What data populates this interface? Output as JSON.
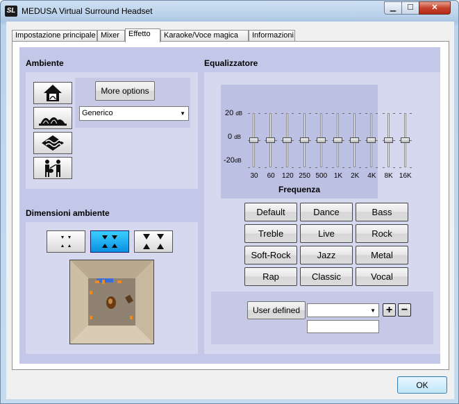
{
  "window": {
    "title": "MEDUSA Virtual Surround Headset",
    "icon_text": "SL",
    "close_glyph": "✕",
    "min_glyph": "▁",
    "max_glyph": "☐"
  },
  "tabs": [
    {
      "label": "Impostazione principale"
    },
    {
      "label": "Mixer"
    },
    {
      "label": "Effetto",
      "active": true
    },
    {
      "label": "Karaoke/Voce magica"
    },
    {
      "label": "Informazioni"
    }
  ],
  "ambiente": {
    "title": "Ambiente",
    "more_options": "More options",
    "selected": "Generico",
    "icons": [
      "house-icon",
      "opera-house-icon",
      "underwater-icon",
      "concert-icon"
    ]
  },
  "dimensioni": {
    "title": "Dimensioni ambiente",
    "selected_index": 1
  },
  "equalizer": {
    "title": "Equalizzatore",
    "db_top": "20",
    "db_mid": "0",
    "db_bottom": "-20",
    "db_unit": "dB",
    "axis_label": "Frequenza",
    "bands": [
      {
        "label": "30",
        "value": 0
      },
      {
        "label": "60",
        "value": 0
      },
      {
        "label": "120",
        "value": 0
      },
      {
        "label": "250",
        "value": 0
      },
      {
        "label": "500",
        "value": 0
      },
      {
        "label": "1K",
        "value": 0
      },
      {
        "label": "2K",
        "value": 0
      },
      {
        "label": "4K",
        "value": 0
      },
      {
        "label": "8K",
        "value": 0
      },
      {
        "label": "16K",
        "value": 0
      }
    ],
    "presets": [
      "Default",
      "Dance",
      "Bass",
      "Treble",
      "Live",
      "Rock",
      "Soft-Rock",
      "Jazz",
      "Metal",
      "Rap",
      "Classic",
      "Vocal"
    ],
    "user_defined": "User defined",
    "user_value": "",
    "name_value": "",
    "add_glyph": "+",
    "remove_glyph": "−"
  },
  "ok": "OK"
}
